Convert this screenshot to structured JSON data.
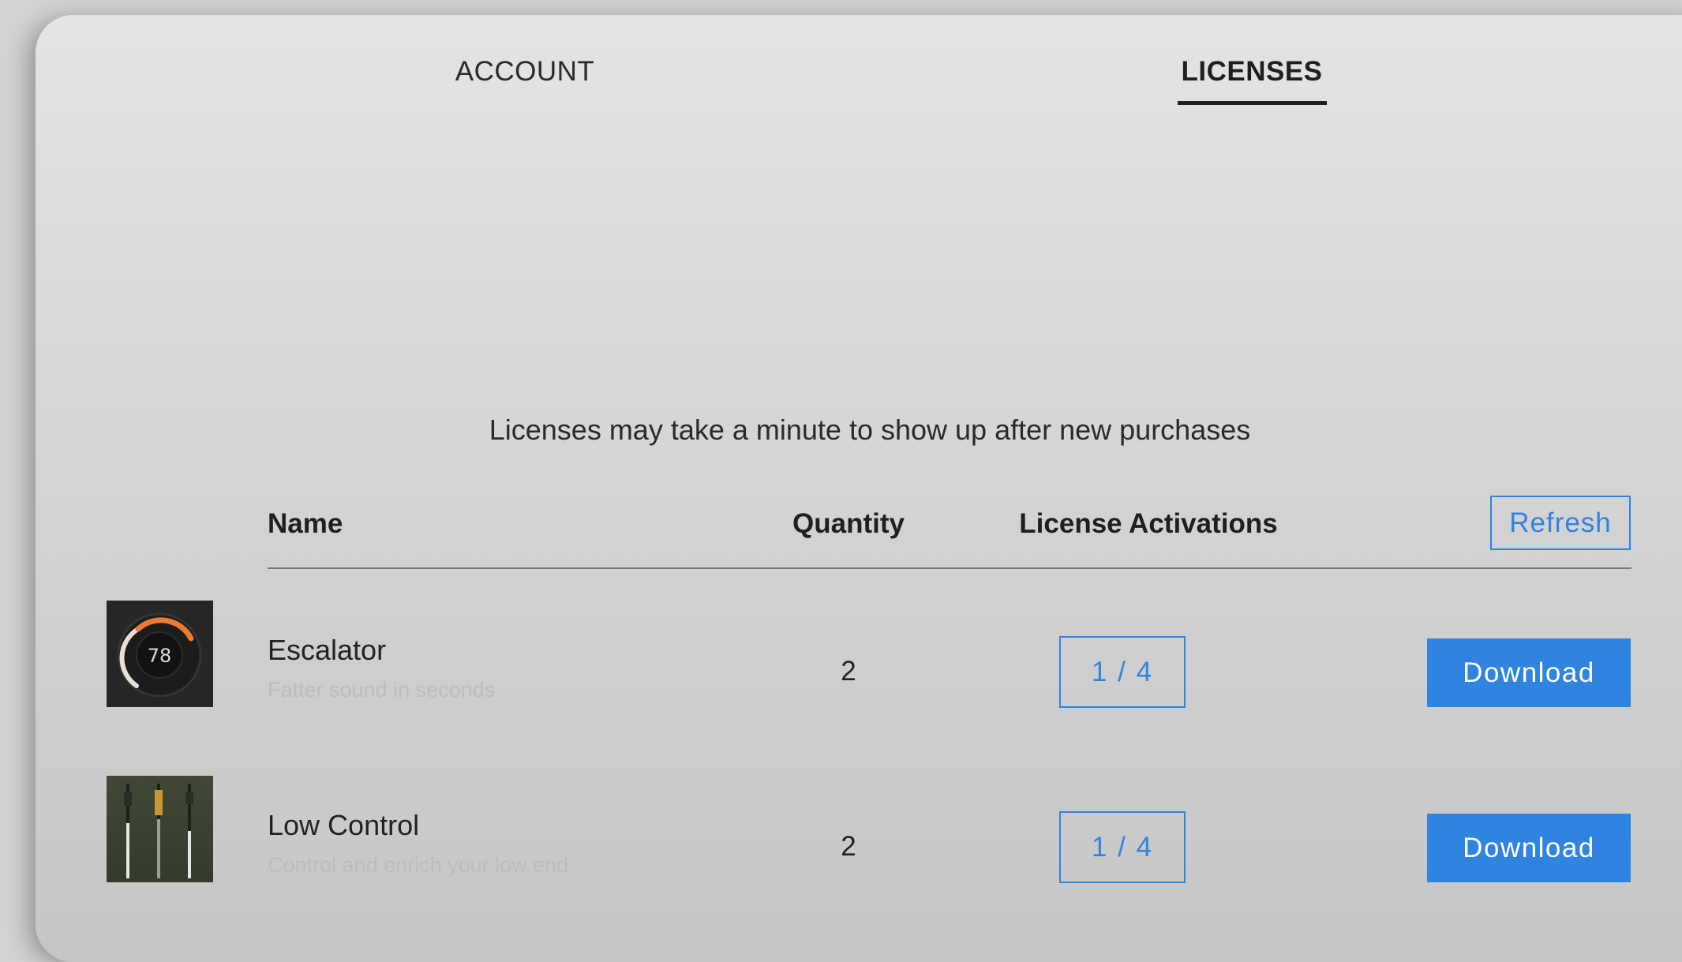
{
  "tabs": {
    "account": "ACCOUNT",
    "licenses": "LICENSES",
    "active": "licenses"
  },
  "notice": "Licenses may take a minute to show up after new purchases",
  "table": {
    "headers": {
      "name": "Name",
      "quantity": "Quantity",
      "activations": "License Activations"
    },
    "refresh_label": "Refresh",
    "rows": [
      {
        "name": "Escalator",
        "description": "Fatter sound in seconds",
        "quantity": "2",
        "activations": "1 / 4",
        "download_label": "Download",
        "thumb_icon": "knob-icon",
        "thumb_value": "78"
      },
      {
        "name": "Low Control",
        "description": "Control and enrich your low end",
        "quantity": "2",
        "activations": "1 / 4",
        "download_label": "Download",
        "thumb_icon": "faders-icon"
      }
    ]
  },
  "colors": {
    "accent": "#2f84e0",
    "text": "#222222",
    "muted": "#bdbdbd"
  }
}
